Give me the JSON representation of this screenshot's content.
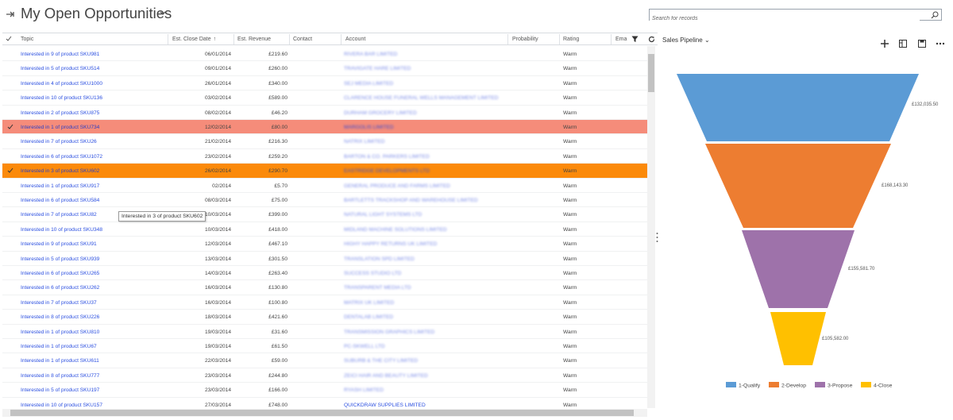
{
  "header": {
    "title": "My Open Opportunities",
    "search_placeholder": "Search for records"
  },
  "grid": {
    "columns": [
      "Topic",
      "Est. Close Date",
      "Est. Revenue",
      "Contact",
      "Account",
      "Probability",
      "Rating",
      "Ema"
    ],
    "sorted_column": "Est. Close Date",
    "rows": [
      {
        "topic": "Interested in 9 of product SKU981",
        "date": "06/01/2014",
        "rev": "£219.60",
        "acct": "RIVERA BAR LIMITED",
        "rating": "Warm",
        "state": ""
      },
      {
        "topic": "Interested in 5 of product SKU514",
        "date": "09/01/2014",
        "rev": "£260.00",
        "acct": "TRAVIGATE HARE LIMITED",
        "rating": "Warm",
        "state": ""
      },
      {
        "topic": "Interested in 4 of product SKU1000",
        "date": "26/01/2014",
        "rev": "£340.00",
        "acct": "SEJ MEDIA LIMITED",
        "rating": "Warm",
        "state": ""
      },
      {
        "topic": "Interested in 10 of product SKU136",
        "date": "03/02/2014",
        "rev": "£589.00",
        "acct": "CLARENCE HOUSE FUNERAL WELLS MANAGEMENT LIMITED",
        "rating": "Warm",
        "state": ""
      },
      {
        "topic": "Interested in 2 of product SKU875",
        "date": "08/02/2014",
        "rev": "£46.20",
        "acct": "DURHAM GROCERY LIMITED",
        "rating": "Warm",
        "state": ""
      },
      {
        "topic": "Interested in 1 of product SKU734",
        "date": "12/02/2014",
        "rev": "£80.00",
        "acct": "MARGOLIS LIMITED",
        "rating": "Warm",
        "state": "sel-salmon"
      },
      {
        "topic": "Interested in 7 of product SKU26",
        "date": "21/02/2014",
        "rev": "£216.30",
        "acct": "NATRIX LIMITED",
        "rating": "Warm",
        "state": ""
      },
      {
        "topic": "Interested in 6 of product SKU1072",
        "date": "23/02/2014",
        "rev": "£259.20",
        "acct": "BARTON & CO. PARKERS LIMITED",
        "rating": "Warm",
        "state": ""
      },
      {
        "topic": "Interested in 3 of product SKU602",
        "date": "26/02/2014",
        "rev": "£290.70",
        "acct": "EASTRIDGE DEVELOPMENTS LTD",
        "rating": "Warm",
        "state": "sel-orange"
      },
      {
        "topic": "Interested in 1 of product SKU917",
        "date": "02/2014",
        "rev": "£5.70",
        "acct": "GENERAL PRODUCE AND FARMS LIMITED",
        "rating": "Warm",
        "state": ""
      },
      {
        "topic": "Interested in 6 of product SKU584",
        "date": "08/03/2014",
        "rev": "£75.00",
        "acct": "BARTLETTS TRACKSHOP AND WAREHOUSE LIMITED",
        "rating": "Warm",
        "state": ""
      },
      {
        "topic": "Interested in 7 of product SKU82",
        "date": "10/03/2014",
        "rev": "£399.00",
        "acct": "NATURAL LIGHT SYSTEMS LTD",
        "rating": "Warm",
        "state": ""
      },
      {
        "topic": "Interested in 10 of product SKU348",
        "date": "10/03/2014",
        "rev": "£418.00",
        "acct": "MIDLAND MACHINE SOLUTIONS LIMITED",
        "rating": "Warm",
        "state": ""
      },
      {
        "topic": "Interested in 9 of product SKU91",
        "date": "12/03/2014",
        "rev": "£467.10",
        "acct": "HIGHY HAPPY RETURNS UK LIMITED",
        "rating": "Warm",
        "state": ""
      },
      {
        "topic": "Interested in 5 of product SKU939",
        "date": "13/03/2014",
        "rev": "£301.50",
        "acct": "TRANSLATION SPD LIMITED",
        "rating": "Warm",
        "state": ""
      },
      {
        "topic": "Interested in 6 of product SKU265",
        "date": "14/03/2014",
        "rev": "£263.40",
        "acct": "SUCCESS STUDIO LTD",
        "rating": "Warm",
        "state": ""
      },
      {
        "topic": "Interested in 6 of product SKU262",
        "date": "16/03/2014",
        "rev": "£130.80",
        "acct": "TRANSPARENT MEDIA LTD",
        "rating": "Warm",
        "state": ""
      },
      {
        "topic": "Interested in 7 of product SKU37",
        "date": "16/03/2014",
        "rev": "£100.80",
        "acct": "MATRIX UK LIMITED",
        "rating": "Warm",
        "state": ""
      },
      {
        "topic": "Interested in 8 of product SKU226",
        "date": "18/03/2014",
        "rev": "£421.60",
        "acct": "DENTALAB LIMITED",
        "rating": "Warm",
        "state": ""
      },
      {
        "topic": "Interested in 1 of product SKU810",
        "date": "19/03/2014",
        "rev": "£31.60",
        "acct": "TRANSMISSION GRAPHICS LIMITED",
        "rating": "Warm",
        "state": ""
      },
      {
        "topic": "Interested in 1 of product SKU67",
        "date": "19/03/2014",
        "rev": "£61.50",
        "acct": "PC-SKWELL LTD",
        "rating": "Warm",
        "state": ""
      },
      {
        "topic": "Interested in 1 of product SKU611",
        "date": "22/03/2014",
        "rev": "£59.00",
        "acct": "SUBURB & THE CITY LIMITED",
        "rating": "Warm",
        "state": ""
      },
      {
        "topic": "Interested in 8 of product SKU777",
        "date": "23/03/2014",
        "rev": "£244.80",
        "acct": "ZEICI HAIR AND BEAUTY LIMITED",
        "rating": "Warm",
        "state": ""
      },
      {
        "topic": "Interested in 5 of product SKU197",
        "date": "23/03/2014",
        "rev": "£166.00",
        "acct": "RYASH LIMITED",
        "rating": "Warm",
        "state": ""
      },
      {
        "topic": "Interested in 10 of product SKU157",
        "date": "27/03/2014",
        "rev": "£748.00",
        "acct": "QUICKDRAW SUPPLIES LIMITED",
        "rating": "Warm",
        "state": "clear"
      }
    ],
    "tooltip": "Interested in 3 of product SKU602"
  },
  "chart": {
    "title": "Sales Pipeline",
    "stages": [
      {
        "name": "1-Qualify",
        "value": "£132,035.50",
        "color": "#5b9bd5"
      },
      {
        "name": "2-Develop",
        "value": "£168,143.30",
        "color": "#ed7d31"
      },
      {
        "name": "3-Propose",
        "value": "£155,581.70",
        "color": "#9e72aa"
      },
      {
        "name": "4-Close",
        "value": "£105,582.00",
        "color": "#ffc000"
      }
    ]
  }
}
